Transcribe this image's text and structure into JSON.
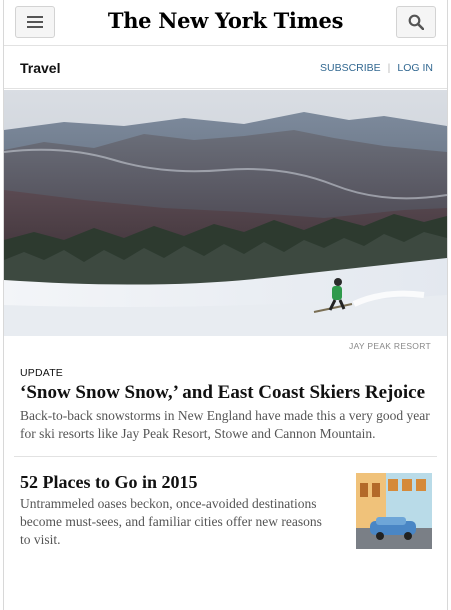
{
  "masthead": {
    "logo_text": "The New York Times"
  },
  "icons": {
    "menu": "hamburger-menu-icon",
    "search": "search-icon"
  },
  "section": {
    "title": "Travel",
    "subscribe_label": "SUBSCRIBE",
    "login_label": "LOG IN"
  },
  "hero": {
    "credit": "JAY PEAK RESORT"
  },
  "stories": [
    {
      "kicker": "UPDATE",
      "headline": "‘Snow Snow Snow,’ and East Coast Skiers Rejoice",
      "summary": "Back-to-back snowstorms in New England have made this a very good year for ski resorts like Jay Peak Resort, Stowe and Cannon Mountain."
    },
    {
      "headline": "52 Places to Go in 2015",
      "summary": "Untrammeled oases beckon, once-avoided destinations become must-sees, and familiar cities offer new reasons to visit."
    }
  ],
  "colors": {
    "link": "#326891",
    "text": "#111111",
    "summary": "#555555"
  }
}
